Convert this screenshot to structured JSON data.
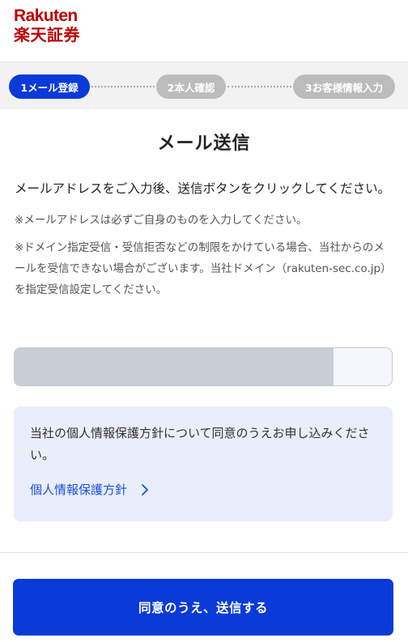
{
  "header": {
    "logo_en": "Rakuten",
    "logo_jp": "楽天証券",
    "brand_color": "#bf0000"
  },
  "steps": [
    {
      "label": "1メール登録",
      "state": "active"
    },
    {
      "label": "2本人確認",
      "state": "inactive"
    },
    {
      "label": "3お客様情報入力",
      "state": "inactive"
    }
  ],
  "main": {
    "title": "メール送信",
    "lead": "メールアドレスをご入力後、送信ボタンをクリックしてください。",
    "note1": "※メールアドレスは必ずご自身のものを入力してください。",
    "note2": "※ドメイン指定受信・受信拒否などの制限をかけている場合、当社からのメールを受信できない場合がございます。当社ドメイン（rakuten-sec.co.jp）を指定受信設定してください。"
  },
  "email": {
    "value": "",
    "placeholder": ""
  },
  "consent": {
    "text": "当社の個人情報保護方針について同意のうえお申し込みください。",
    "link_label": "個人情報保護方針"
  },
  "footer": {
    "submit_label": "同意のうえ、送信する"
  },
  "colors": {
    "accent": "#0a3ad8",
    "inactive_step": "#bcbcbc",
    "link": "#1a4fe0",
    "consent_bg": "#e9eefa"
  }
}
